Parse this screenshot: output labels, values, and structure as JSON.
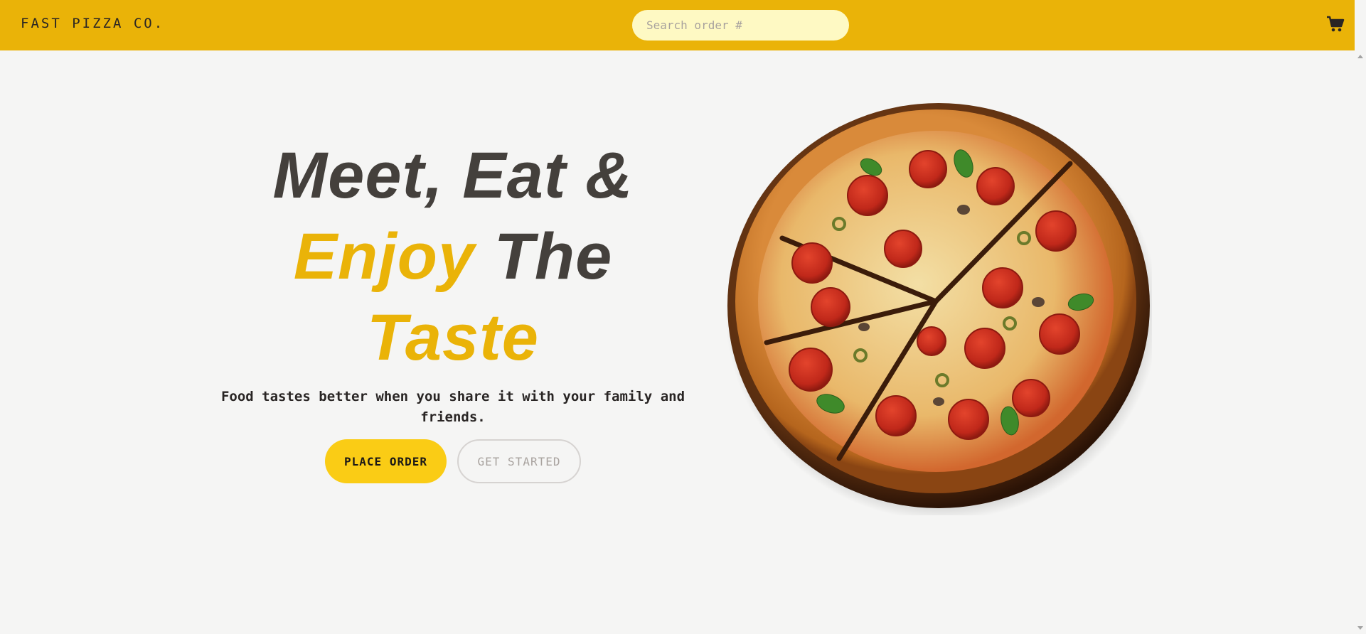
{
  "header": {
    "brand": "FAST PIZZA CO.",
    "search_placeholder": "Search order #",
    "cart_icon": "cart-icon"
  },
  "hero": {
    "line1": "Meet, Eat &",
    "line2_accent": "Enjoy",
    "line2_rest": " The",
    "line3_accent": "Taste",
    "tagline": "Food tastes better when you share it with your family and friends.",
    "primary_button": "PLACE ORDER",
    "secondary_button": "GET STARTED"
  },
  "colors": {
    "header_bg": "#eab308",
    "accent": "#eab308",
    "primary_button": "#facc15",
    "page_bg": "#f5f5f4",
    "text_dark": "#44403c"
  }
}
